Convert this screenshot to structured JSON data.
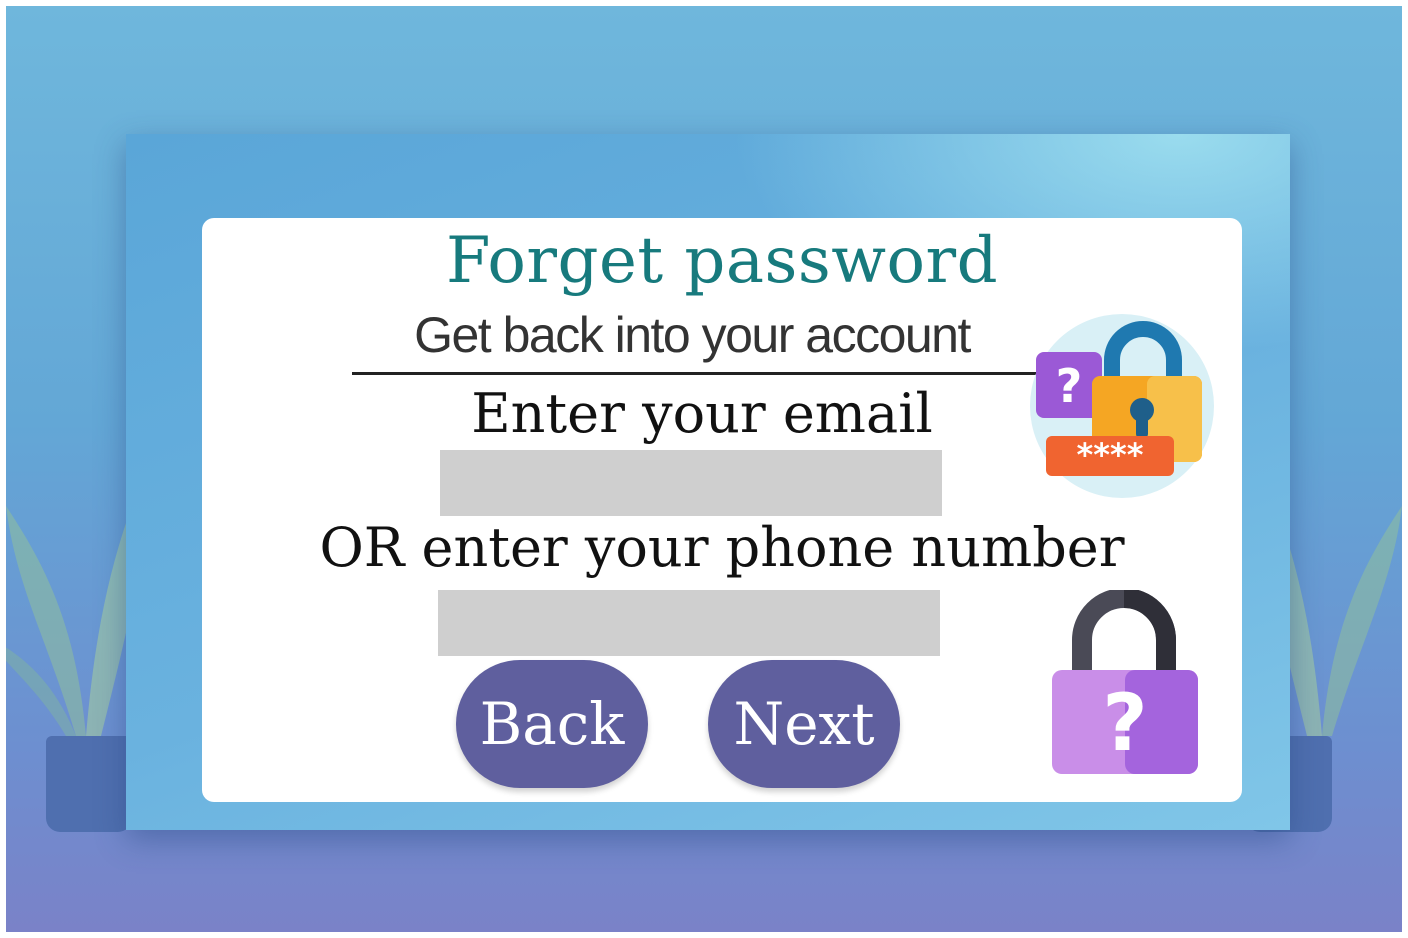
{
  "card": {
    "title": "Forget password",
    "subtitle": "Get back into your account",
    "email_label": "Enter your email",
    "email_value": "",
    "phone_label": "OR enter your phone number",
    "phone_value": "",
    "back_label": "Back",
    "next_label": "Next"
  },
  "icons": {
    "top": "password-lock-icon",
    "top_badge_text": "****",
    "top_question": "?",
    "bottom": "padlock-question-icon",
    "bottom_question": "?"
  },
  "colors": {
    "title": "#177a7d",
    "button": "#5f5f9e",
    "input": "#cfcfcf"
  }
}
